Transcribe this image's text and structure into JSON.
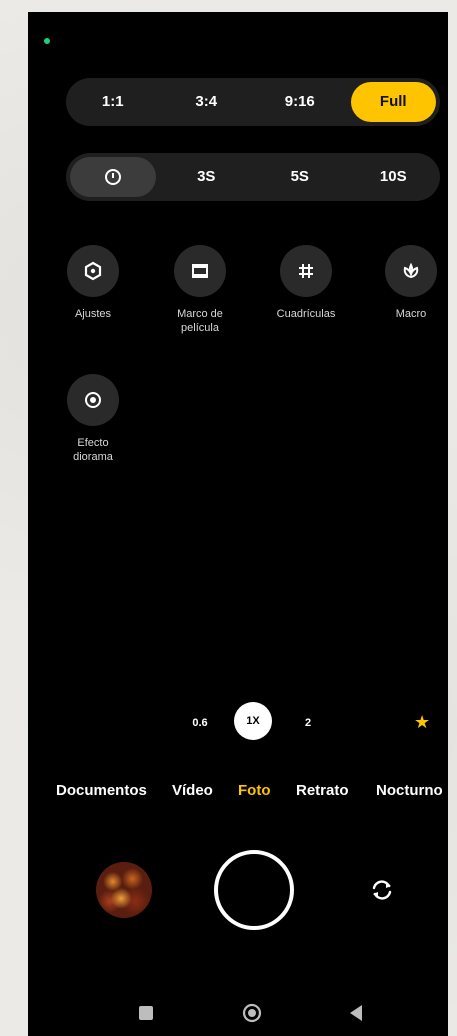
{
  "ratio_options": [
    "1:1",
    "3:4",
    "9:16",
    "Full"
  ],
  "ratio_selected": "Full",
  "timer_options": [
    "3S",
    "5S",
    "10S"
  ],
  "tools": [
    {
      "label": "Ajustes",
      "icon": "settings-icon"
    },
    {
      "label": "Marco de\npelícula",
      "icon": "film-frame-icon"
    },
    {
      "label": "Cuadrículas",
      "icon": "grid-icon"
    },
    {
      "label": "Macro",
      "icon": "macro-flower-icon"
    },
    {
      "label": "Efecto\ndiorama",
      "icon": "diorama-icon"
    }
  ],
  "zoom": {
    "wide": "0.6",
    "normal": "1X",
    "tele": "2"
  },
  "modes": [
    "Documentos",
    "Vídeo",
    "Foto",
    "Retrato",
    "Nocturno"
  ],
  "active_mode": "Foto",
  "colors": {
    "accent": "#ffc400",
    "background": "#000000",
    "surface": "#1f1f1f"
  }
}
